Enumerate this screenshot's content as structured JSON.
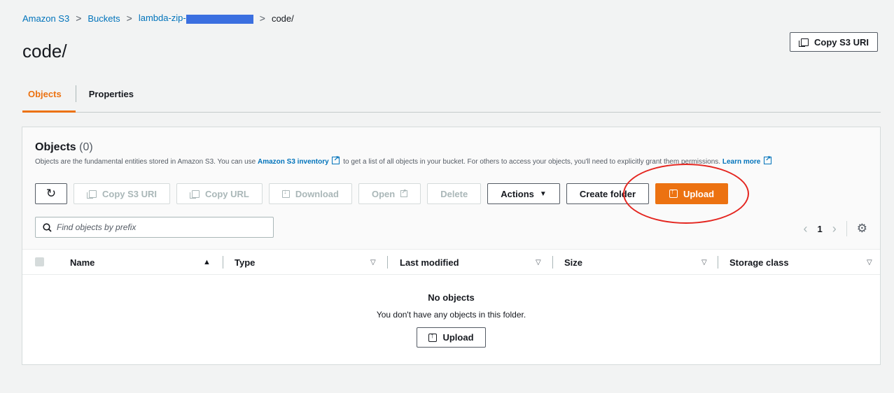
{
  "breadcrumb": {
    "items": [
      "Amazon S3",
      "Buckets",
      "lambda-zip-"
    ],
    "current": "code/",
    "separator": ">"
  },
  "page": {
    "title": "code/",
    "copy_uri_label": "Copy S3 URI"
  },
  "tabs": [
    {
      "label": "Objects",
      "active": true
    },
    {
      "label": "Properties",
      "active": false
    }
  ],
  "objects_panel": {
    "title": "Objects",
    "count": "(0)",
    "description_pre": "Objects are the fundamental entities stored in Amazon S3. You can use ",
    "inventory_link": "Amazon S3 inventory",
    "description_post": " to get a list of all objects in your bucket. For others to access your objects, you'll need to explicitly grant them permissions. ",
    "learn_more": "Learn more"
  },
  "toolbar": {
    "copy_uri": "Copy S3 URI",
    "copy_url": "Copy URL",
    "download": "Download",
    "open": "Open",
    "delete": "Delete",
    "actions": "Actions",
    "create_folder": "Create folder",
    "upload": "Upload"
  },
  "search": {
    "placeholder": "Find objects by prefix"
  },
  "pagination": {
    "page": "1"
  },
  "table": {
    "columns": [
      "Name",
      "Type",
      "Last modified",
      "Size",
      "Storage class"
    ]
  },
  "empty_state": {
    "title": "No objects",
    "message": "You don't have any objects in this folder.",
    "upload_label": "Upload"
  },
  "colors": {
    "accent": "#ec7211",
    "link": "#0073bb",
    "annotation": "#e4251f"
  }
}
